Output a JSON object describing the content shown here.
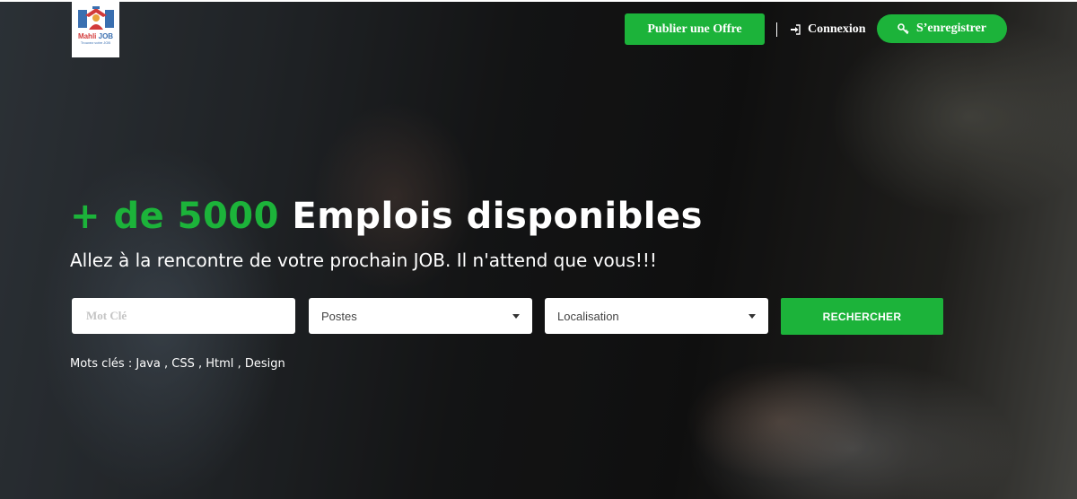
{
  "brand": {
    "logo_name": "Mahli JOB",
    "logo_name_accent": "Mahli",
    "logo_name_rest": " JOB",
    "logo_tagline": "Trouvez votre JOB"
  },
  "header": {
    "publish_label": "Publier une Offre",
    "login_label": "Connexion",
    "register_label": "S’enregistrer"
  },
  "hero": {
    "headline_accent": "+ de 5000",
    "headline_rest": " Emplois disponibles",
    "subheadline": "Allez à la rencontre de votre prochain JOB. Il n'attend que vous!!!"
  },
  "search": {
    "keyword_placeholder": "Mot Clé",
    "keyword_value": "",
    "position_selected": "Postes",
    "location_selected": "Localisation",
    "submit_label": "RECHERCHER"
  },
  "keywords": {
    "label": "Mots clés :",
    "items": [
      "Java",
      "CSS",
      "Html",
      "Design"
    ],
    "separator": ","
  },
  "colors": {
    "accent": "#1cb33a",
    "text_on_dark": "#ffffff",
    "field_bg": "#ffffff",
    "placeholder": "#c4c4c4"
  },
  "icons": {
    "login": "sign-in-icon",
    "register": "key-icon",
    "select_caret": "caret-down-icon"
  }
}
